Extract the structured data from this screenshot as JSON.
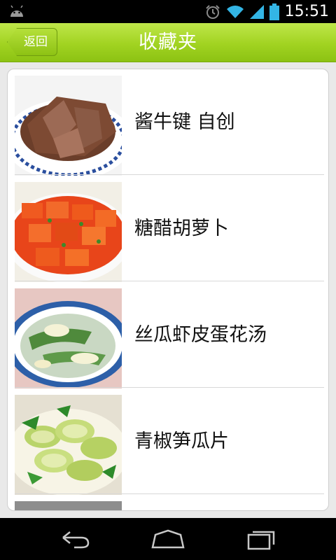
{
  "status_bar": {
    "time": "15:51",
    "icons": [
      "android-icon",
      "alarm-icon",
      "wifi-icon",
      "signal-icon",
      "battery-icon"
    ]
  },
  "header": {
    "back_label": "返回",
    "title": "收藏夹"
  },
  "favorites": [
    {
      "name": "酱牛键  自创",
      "image": "sliced-braised-beef"
    },
    {
      "name": "糖醋胡萝卜",
      "image": "sweet-sour-carrots"
    },
    {
      "name": "丝瓜虾皮蛋花汤",
      "image": "loofah-egg-soup"
    },
    {
      "name": "青椒笋瓜片",
      "image": "green-pepper-zucchini"
    }
  ],
  "nav_bar": {
    "icons": [
      "back-icon",
      "home-icon",
      "recent-apps-icon"
    ]
  },
  "colors": {
    "header_green": "#a1d321",
    "background": "#e9e9e9",
    "card": "#ffffff"
  }
}
